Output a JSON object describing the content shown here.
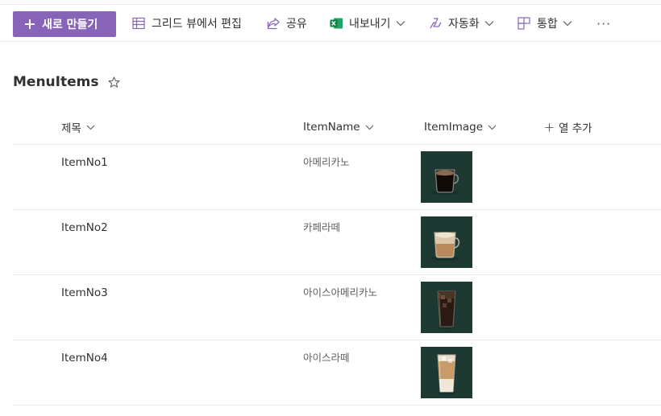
{
  "toolbar": {
    "new_label": "새로 만들기",
    "grid_label": "그리드 뷰에서 편집",
    "share_label": "공유",
    "export_label": "내보내기",
    "automate_label": "자동화",
    "integrate_label": "통합",
    "more_label": "···"
  },
  "list": {
    "title": "MenuItems"
  },
  "columns": {
    "title": "제목",
    "item_name": "ItemName",
    "item_image": "ItemImage",
    "add_column": "열 추가"
  },
  "rows": [
    {
      "title": "ItemNo1",
      "item_name": "아메리카노",
      "drink": "hot-americano"
    },
    {
      "title": "ItemNo2",
      "item_name": "카페라떼",
      "drink": "hot-latte"
    },
    {
      "title": "ItemNo3",
      "item_name": "아이스아메리카노",
      "drink": "iced-americano"
    },
    {
      "title": "ItemNo4",
      "item_name": "아이스라떼",
      "drink": "iced-latte"
    }
  ],
  "colors": {
    "accent": "#8764b8",
    "thumb_background": "#1e3932",
    "excel_green": "#107c41"
  }
}
